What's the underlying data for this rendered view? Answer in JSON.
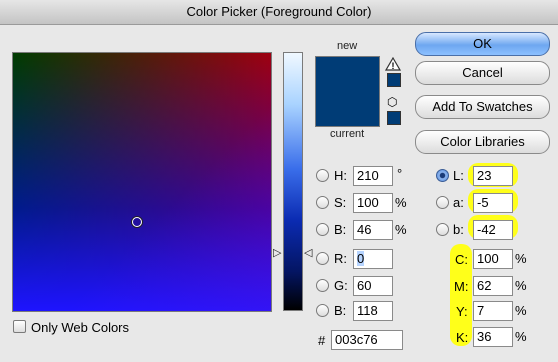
{
  "window": {
    "title": "Color Picker (Foreground Color)"
  },
  "preview": {
    "new_label": "new",
    "current_label": "current",
    "new_color": "#003c76",
    "current_color": "#003c76"
  },
  "buttons": {
    "ok": "OK",
    "cancel": "Cancel",
    "add_swatches": "Add To Swatches",
    "color_libraries": "Color Libraries"
  },
  "hsb": {
    "h": {
      "label": "H:",
      "value": "210",
      "unit": "°"
    },
    "s": {
      "label": "S:",
      "value": "100",
      "unit": "%"
    },
    "b": {
      "label": "B:",
      "value": "46",
      "unit": "%"
    }
  },
  "rgb": {
    "r": {
      "label": "R:",
      "value": "0"
    },
    "g": {
      "label": "G:",
      "value": "60"
    },
    "b": {
      "label": "B:",
      "value": "118"
    }
  },
  "lab": {
    "l": {
      "label": "L:",
      "value": "23"
    },
    "a": {
      "label": "a:",
      "value": "-5"
    },
    "b": {
      "label": "b:",
      "value": "-42"
    }
  },
  "cmyk": {
    "c": {
      "label": "C:",
      "value": "100",
      "unit": "%"
    },
    "m": {
      "label": "M:",
      "value": "62",
      "unit": "%"
    },
    "y": {
      "label": "Y:",
      "value": "7",
      "unit": "%"
    },
    "k": {
      "label": "K:",
      "value": "36",
      "unit": "%"
    }
  },
  "hex": {
    "label": "#",
    "value": "003c76"
  },
  "web_colors": {
    "label": "Only Web Colors",
    "checked": false
  },
  "highlight_color": "#ffff1a"
}
